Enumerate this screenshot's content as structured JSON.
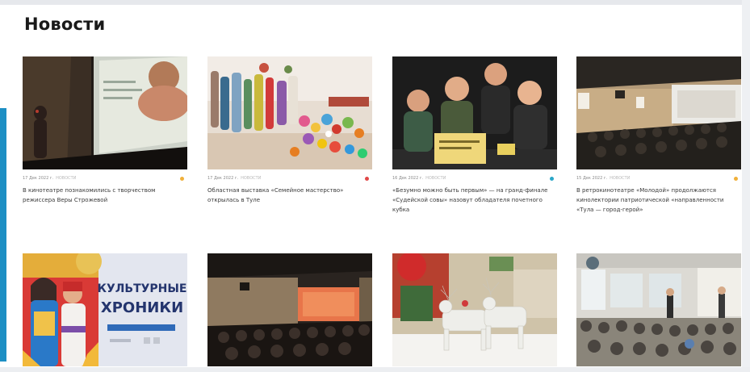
{
  "section": {
    "title": "Новости"
  },
  "colors": {
    "accent": "#1d8fc4"
  },
  "cards": [
    {
      "date": "17 Дек 2022 г.",
      "category": "НОВОСТИ",
      "title": "В кинотеатре познакомились с творчеством режиссера Веры Строжевой",
      "dot": "#f0b03a",
      "image": "cinema-hall-projection"
    },
    {
      "date": "17 Дек 2022 г.",
      "category": "НОВОСТИ",
      "title": "Областная выставка «Семейное мастерство» открылась в Туле",
      "dot": "#e04848",
      "image": "crafts-exhibition"
    },
    {
      "date": "16 Дек 2022 г.",
      "category": "НОВОСТИ",
      "title": "«Безумно можно быть первым» — на гранд-финале «Судейской совы» назовут обладателя почетного кубка",
      "dot": "#2aa6c8",
      "image": "quiz-team"
    },
    {
      "date": "15 Дек 2022 г.",
      "category": "НОВОСТИ",
      "title": "В ретрокинотеатре «Молодой» продолжаются кинолектории патриотической «направленности «Тула — город-герой»",
      "dot": "#f0b03a",
      "image": "retro-cinema"
    },
    {
      "date": "",
      "category": "",
      "title": "",
      "dot": "",
      "image": "kulturnye-hroniki-poster",
      "poster": {
        "line1": "КУЛЬТУРНЫЕ",
        "line2": "ХРОНИКИ"
      }
    },
    {
      "date": "",
      "category": "",
      "title": "",
      "dot": "",
      "image": "cinema-screening"
    },
    {
      "date": "",
      "category": "",
      "title": "",
      "dot": "",
      "image": "reindeer-sculpture"
    },
    {
      "date": "",
      "category": "",
      "title": "",
      "dot": "",
      "image": "lecture-hall-audience"
    }
  ]
}
